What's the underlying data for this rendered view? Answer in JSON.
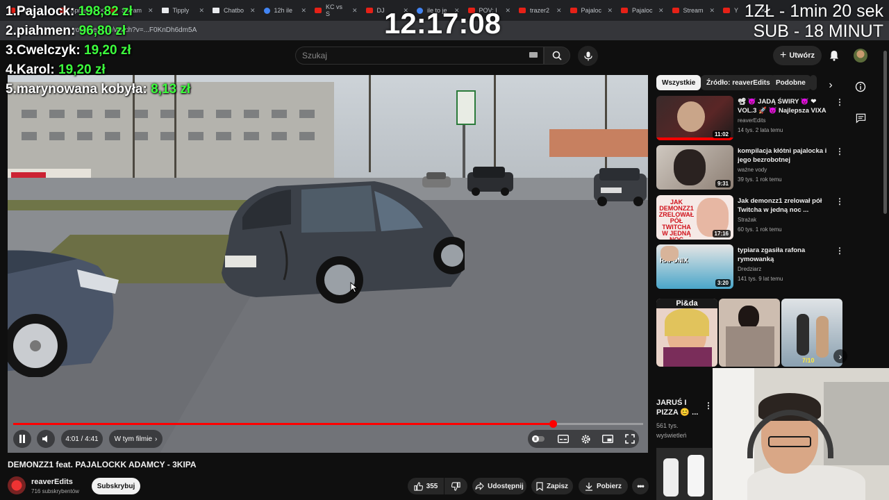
{
  "tabs": [
    {
      "label": "Inbox",
      "icon": "mail-icon"
    },
    {
      "label": "Sprzedaj",
      "icon": "youtube-icon"
    },
    {
      "label": "Stream",
      "icon": "youtube-icon"
    },
    {
      "label": "Tipply",
      "icon": "tipply-icon"
    },
    {
      "label": "Chatbo",
      "icon": "chatbot-icon"
    },
    {
      "label": "12h ile",
      "icon": "google-icon"
    },
    {
      "label": "KC vs S",
      "icon": "youtube-icon"
    },
    {
      "label": "DJ",
      "icon": "youtube-icon"
    },
    {
      "label": "ile to je",
      "icon": "google-icon"
    },
    {
      "label": "POV: I",
      "icon": "youtube-icon"
    },
    {
      "label": "trazer2",
      "icon": "youtube-icon"
    },
    {
      "label": "Pajaloc",
      "icon": "youtube-icon"
    },
    {
      "label": "Pajaloc",
      "icon": "youtube-icon"
    },
    {
      "label": "Stream",
      "icon": "youtube-icon"
    },
    {
      "label": "Y",
      "icon": "youtube-icon"
    }
  ],
  "url": "youtube.com/watch?v=...F0KnDh6dm5A",
  "header": {
    "search_placeholder": "Szukaj",
    "create_label": "Utwórz"
  },
  "overlay": {
    "donations": [
      {
        "rank": "1.",
        "name": "Pajalock:",
        "amount": "198,82 zł"
      },
      {
        "rank": "2.",
        "name": "piahmen:",
        "amount": "96,80 zł"
      },
      {
        "rank": "3.",
        "name": "Cwelczyk:",
        "amount": "19,20 zł"
      },
      {
        "rank": "4.",
        "name": "Karol:",
        "amount": "19,20 zł"
      },
      {
        "rank": "5.",
        "name": "marynowana kobyła:",
        "amount": "8,13 zł"
      }
    ],
    "clock": "12:17:08",
    "timer_line1": "1ZŁ - 1min 20 sek",
    "timer_line2": "SUB - 18 MINUT"
  },
  "player": {
    "time": "4:01 / 4:41",
    "chapters_label": "W tym filmie",
    "progress": 0.857
  },
  "video": {
    "title": "DEMONZZ1 feat. PAJALOCKK ADAMCY - 3KIPA",
    "channel": "reaverEdits",
    "subscribers": "716 subskrybentów",
    "subscribe_label": "Subskrybuj",
    "likes": "355",
    "share_label": "Udostępnij",
    "save_label": "Zapisz",
    "download_label": "Pobierz"
  },
  "chips": [
    "Wszystkie",
    "Źródło: reaverEdits",
    "Podobne"
  ],
  "recommendations": [
    {
      "title": "📽 😈 JADĄ ŚWIRY 😈 ❤ VOL.3 🚀 😈 Najlepsza VIXA DO ...",
      "channel": "reaverEdits",
      "meta": "14 tys.  2 lata temu",
      "duration": "11:02"
    },
    {
      "title": "kompilacja kłótni pajalocka i jego bezrobotnej dziewczyny ...",
      "channel": "ważne vody",
      "meta": "39 tys.  1 rok temu",
      "duration": "9:31"
    },
    {
      "title": "Jak demonzz1 zrelował pół Twitcha w jedną noc ...",
      "channel": "Strażak",
      "meta": "60 tys.  1 rok temu",
      "duration": "17:16",
      "thumb_text": "JAK DEMONZZ1 ZRELOWAŁ PÓŁ TWITCHA W JEDNĄ NOC"
    },
    {
      "title": "typiara zgasiła rafona rymowanką",
      "channel": "Dredziarz",
      "meta": "141 tys.  9 lat temu",
      "duration": "3:20",
      "thumb_text": "RAFONIX"
    }
  ],
  "shorts": {
    "first_title": "JARUŚ I PIZZA 😊 ...",
    "first_views": "561 tys. wyświetleń",
    "thumb_label": "Pi&da",
    "thumb3_label": "7/10"
  },
  "colors": {
    "accent": "#ff0000",
    "donation_amount": "#3dff3d",
    "background": "#0f0f0f"
  }
}
